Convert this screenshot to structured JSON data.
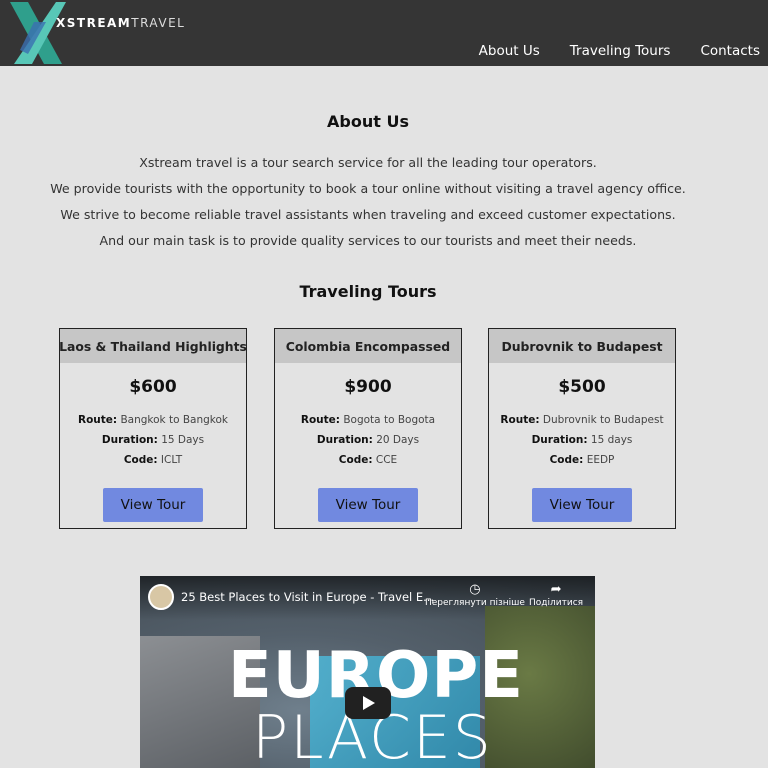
{
  "header": {
    "brand_bold": "XSTREAM",
    "brand_light": "TRAVEL",
    "nav": [
      "About Us",
      "Traveling Tours",
      "Contacts"
    ]
  },
  "about": {
    "title": "About Us",
    "lines": [
      "Xstream travel is a tour search service for all the leading tour operators.",
      "We provide tourists with the opportunity to book a tour online without visiting a travel agency office.",
      "We strive to become reliable travel assistants when traveling and exceed customer expectations.",
      "And our main task is to provide quality services to our tourists and meet their needs."
    ]
  },
  "tours": {
    "title": "Traveling Tours",
    "route_label": "Route:",
    "duration_label": "Duration:",
    "code_label": "Code:",
    "items": [
      {
        "name": "Laos & Thailand Highlights",
        "price": "$600",
        "route": "Bangkok to Bangkok",
        "duration": "15 Days",
        "code": "ICLT",
        "button": "View Tour"
      },
      {
        "name": "Colombia Encompassed",
        "price": "$900",
        "route": "Bogota to Bogota",
        "duration": "20 Days",
        "code": "CCE",
        "button": "View Tour"
      },
      {
        "name": "Dubrovnik to Budapest",
        "price": "$500",
        "route": "Dubrovnik to Budapest",
        "duration": "15 days",
        "code": "EEDP",
        "button": "View Tour"
      }
    ]
  },
  "video": {
    "title": "25 Best Places to Visit in Europe - Travel E...",
    "watch_later": "Переглянути пізніше",
    "share": "Поділитися",
    "overlay_line1": "EUROPE",
    "overlay_line2": "PLACES"
  },
  "colors": {
    "header_bg": "#353535",
    "page_bg": "#e3e3e3",
    "card_head_bg": "#c6c6c6",
    "button_bg": "#7189e0",
    "logo_teal": "#3fb8a6"
  }
}
